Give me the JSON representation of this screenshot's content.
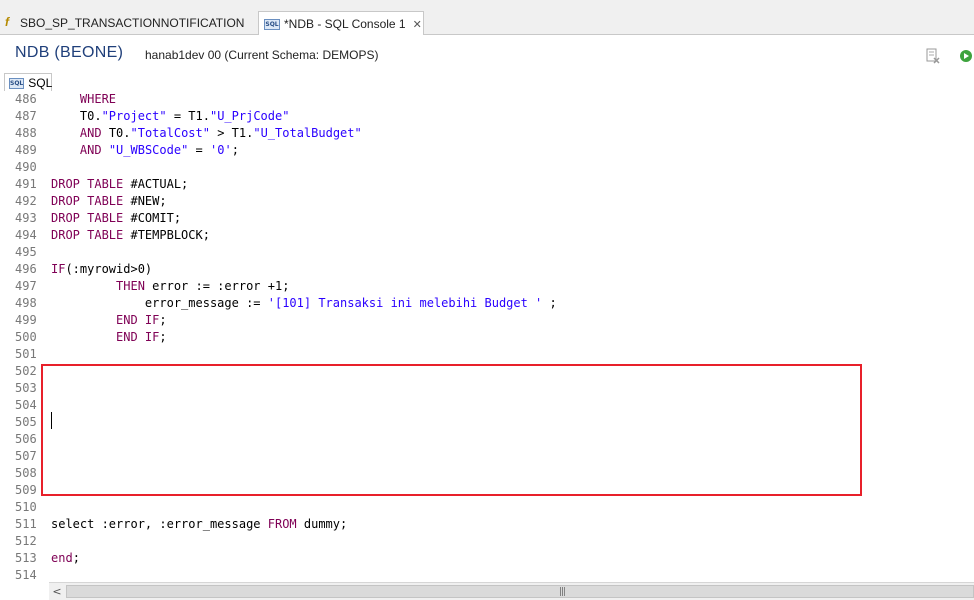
{
  "tabs": [
    {
      "label": "SBO_SP_TRANSACTIONNOTIFICATION",
      "icon": "function-icon"
    },
    {
      "label": "*NDB - SQL Console 1",
      "icon": "sql-console-icon",
      "close": "✕"
    }
  ],
  "header": {
    "title": "NDB (BEONE)",
    "subtitle": "hanab1dev 00 (Current Schema: DEMOPS)"
  },
  "sql_icon_text": "SQL",
  "subtab_label": "SQL",
  "editor": {
    "lines": [
      {
        "n": "486",
        "segs": [
          [
            "    ",
            ""
          ],
          [
            "WHERE",
            "kw"
          ]
        ]
      },
      {
        "n": "487",
        "segs": [
          [
            "    T0.",
            ""
          ],
          [
            "\"Project\"",
            "str"
          ],
          [
            " = T1.",
            ""
          ],
          [
            "\"U_PrjCode\"",
            "str"
          ]
        ]
      },
      {
        "n": "488",
        "segs": [
          [
            "    ",
            ""
          ],
          [
            "AND",
            "kw"
          ],
          [
            " T0.",
            ""
          ],
          [
            "\"TotalCost\"",
            "str"
          ],
          [
            " > T1.",
            ""
          ],
          [
            "\"U_TotalBudget\"",
            "str"
          ]
        ]
      },
      {
        "n": "489",
        "segs": [
          [
            "    ",
            ""
          ],
          [
            "AND",
            "kw"
          ],
          [
            " ",
            ""
          ],
          [
            "\"U_WBSCode\"",
            "str"
          ],
          [
            " = ",
            ""
          ],
          [
            "'0'",
            "str"
          ],
          [
            ";",
            ""
          ]
        ]
      },
      {
        "n": "490",
        "segs": []
      },
      {
        "n": "491",
        "segs": [
          [
            "DROP TABLE",
            "kw"
          ],
          [
            " #ACTUAL;",
            ""
          ]
        ]
      },
      {
        "n": "492",
        "segs": [
          [
            "DROP TABLE",
            "kw"
          ],
          [
            " #NEW;",
            ""
          ]
        ]
      },
      {
        "n": "493",
        "segs": [
          [
            "DROP TABLE",
            "kw"
          ],
          [
            " #COMIT;",
            ""
          ]
        ]
      },
      {
        "n": "494",
        "segs": [
          [
            "DROP TABLE",
            "kw"
          ],
          [
            " #TEMPBLOCK;",
            ""
          ]
        ]
      },
      {
        "n": "495",
        "segs": []
      },
      {
        "n": "496",
        "segs": [
          [
            "IF",
            "kw"
          ],
          [
            "(:myrowid>0)",
            ""
          ]
        ]
      },
      {
        "n": "497",
        "segs": [
          [
            "         ",
            ""
          ],
          [
            "THEN",
            "kw"
          ],
          [
            " error := :error +1;",
            ""
          ]
        ]
      },
      {
        "n": "498",
        "segs": [
          [
            "             error_message := ",
            ""
          ],
          [
            "'[101] Transaksi ini melebihi Budget '",
            "str"
          ],
          [
            " ;",
            ""
          ]
        ]
      },
      {
        "n": "499",
        "segs": [
          [
            "         ",
            ""
          ],
          [
            "END IF",
            "kw"
          ],
          [
            ";",
            ""
          ]
        ]
      },
      {
        "n": "500",
        "segs": [
          [
            "         ",
            ""
          ],
          [
            "END IF",
            "kw"
          ],
          [
            ";",
            ""
          ]
        ]
      },
      {
        "n": "501",
        "segs": []
      },
      {
        "n": "502",
        "segs": []
      },
      {
        "n": "503",
        "segs": []
      },
      {
        "n": "504",
        "segs": []
      },
      {
        "n": "505",
        "segs": []
      },
      {
        "n": "506",
        "segs": []
      },
      {
        "n": "507",
        "segs": []
      },
      {
        "n": "508",
        "segs": []
      },
      {
        "n": "509",
        "segs": []
      },
      {
        "n": "510",
        "segs": []
      },
      {
        "n": "511",
        "segs": [
          [
            "select :error, :error_message ",
            ""
          ],
          [
            "FROM",
            "kw"
          ],
          [
            " dummy;",
            ""
          ]
        ]
      },
      {
        "n": "512",
        "segs": []
      },
      {
        "n": "513",
        "segs": [
          [
            "end",
            "kw"
          ],
          [
            ";",
            ""
          ]
        ]
      },
      {
        "n": "514",
        "segs": []
      }
    ]
  },
  "scrollbar": {
    "left_arrow": "<",
    "grip": "|||"
  },
  "colors": {
    "keyword": "#7f0055",
    "string": "#2a00ff",
    "highlight": "#e8202a"
  }
}
